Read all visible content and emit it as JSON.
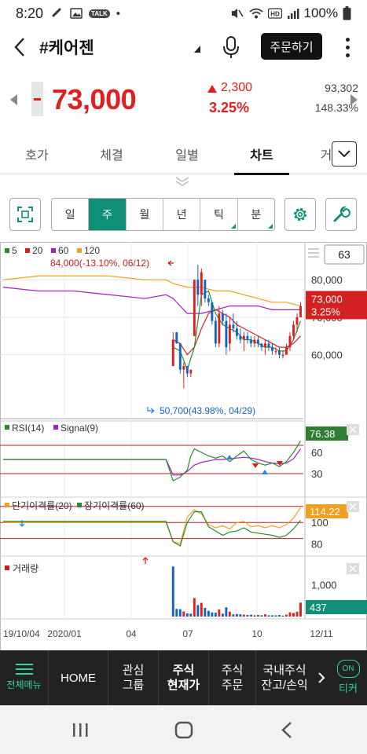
{
  "status": {
    "time": "8:20",
    "battery": "100%"
  },
  "header": {
    "stock_name": "#케어젠",
    "order_label": "주문하기"
  },
  "price": {
    "current": "73,000",
    "change": "2,300",
    "change_pct": "3.25%",
    "volume": "93,302",
    "volume_ratio": "148.33%"
  },
  "tabs": [
    "호가",
    "체결",
    "일별",
    "차트",
    "거"
  ],
  "active_tab": "차트",
  "periods": [
    "일",
    "주",
    "월",
    "년",
    "틱",
    "분"
  ],
  "active_period": "주",
  "chart_data": {
    "type": "candlestick",
    "x_tick_labels": [
      "19/10/04",
      "2020/01",
      "04",
      "07",
      "10",
      "12/11"
    ],
    "price_panel": {
      "legend": [
        {
          "name": "5",
          "color": "#2a8a2a"
        },
        {
          "name": "20",
          "color": "#d62020"
        },
        {
          "name": "60",
          "color": "#a020c0"
        },
        {
          "name": "120",
          "color": "#f0a020"
        }
      ],
      "y_ticks": [
        80000,
        70000,
        60000
      ],
      "ylim": [
        44000,
        88000
      ],
      "period_box": "63",
      "current_badge": {
        "price": "73,000",
        "pct": "3.25%"
      },
      "high_annotation": "84,000(-13.10%, 06/12)",
      "low_annotation": "50,700(43.98%, 04/29)",
      "candles": [
        [
          48,
          57,
          66,
          57,
          64
        ],
        [
          49,
          66,
          66,
          63,
          63
        ],
        [
          50,
          63,
          63,
          55,
          56
        ],
        [
          51,
          56,
          58,
          51,
          57
        ],
        [
          52,
          57,
          57,
          54,
          55
        ],
        [
          53,
          55,
          56,
          54,
          56
        ],
        [
          54,
          65,
          80,
          65,
          80
        ],
        [
          55,
          80,
          84,
          73,
          76
        ],
        [
          56,
          76,
          83,
          73,
          82
        ],
        [
          57,
          80,
          80,
          74,
          75
        ],
        [
          58,
          75,
          76,
          73,
          74
        ],
        [
          59,
          74,
          74,
          68,
          69
        ],
        [
          60,
          69,
          70,
          62,
          63
        ],
        [
          61,
          63,
          73,
          62,
          71
        ],
        [
          62,
          71,
          72,
          68,
          69
        ],
        [
          63,
          69,
          71,
          60,
          62
        ],
        [
          64,
          63,
          70,
          61,
          68
        ],
        [
          65,
          68,
          71,
          66,
          67
        ],
        [
          66,
          67,
          69,
          64,
          65
        ],
        [
          67,
          65,
          67,
          63,
          64
        ],
        [
          68,
          64,
          66,
          61,
          65
        ],
        [
          69,
          65,
          66,
          63,
          64
        ],
        [
          70,
          64,
          65,
          62,
          63
        ],
        [
          71,
          63,
          65,
          62,
          64
        ],
        [
          72,
          64,
          65,
          62,
          63
        ],
        [
          73,
          63,
          63,
          61,
          62
        ],
        [
          74,
          62,
          64,
          60,
          63
        ],
        [
          75,
          63,
          64,
          61,
          62
        ],
        [
          76,
          62,
          63,
          60,
          61
        ],
        [
          77,
          61,
          62,
          60,
          61
        ],
        [
          78,
          61,
          62,
          59,
          60
        ],
        [
          79,
          60,
          61,
          59,
          60
        ],
        [
          80,
          60,
          63,
          60,
          62
        ],
        [
          81,
          62,
          66,
          61,
          65
        ],
        [
          82,
          65,
          69,
          64,
          68
        ],
        [
          83,
          68,
          71,
          66,
          70
        ],
        [
          84,
          70,
          74,
          70,
          73
        ]
      ],
      "ma5": [
        [
          48,
          62
        ],
        [
          50,
          61
        ],
        [
          52,
          56
        ],
        [
          54,
          62
        ],
        [
          56,
          76
        ],
        [
          58,
          77
        ],
        [
          60,
          71
        ],
        [
          62,
          68
        ],
        [
          64,
          67
        ],
        [
          66,
          66
        ],
        [
          68,
          64
        ],
        [
          70,
          64
        ],
        [
          72,
          63
        ],
        [
          74,
          62
        ],
        [
          76,
          62
        ],
        [
          78,
          61
        ],
        [
          80,
          61
        ],
        [
          82,
          64
        ],
        [
          84,
          69
        ]
      ],
      "ma20": [
        [
          48,
          64
        ],
        [
          50,
          63
        ],
        [
          52,
          60
        ],
        [
          54,
          62
        ],
        [
          56,
          67
        ],
        [
          58,
          71
        ],
        [
          60,
          72
        ],
        [
          62,
          71
        ],
        [
          64,
          70
        ],
        [
          66,
          68
        ],
        [
          68,
          67
        ],
        [
          70,
          66
        ],
        [
          72,
          65
        ],
        [
          74,
          64
        ],
        [
          76,
          63
        ],
        [
          78,
          62
        ],
        [
          80,
          62
        ],
        [
          82,
          63
        ],
        [
          84,
          65
        ]
      ],
      "ma60": [
        [
          0,
          78
        ],
        [
          10,
          77
        ],
        [
          20,
          77
        ],
        [
          30,
          76
        ],
        [
          40,
          75
        ],
        [
          46,
          76
        ],
        [
          48,
          75
        ],
        [
          52,
          71
        ],
        [
          56,
          71
        ],
        [
          60,
          72
        ],
        [
          64,
          73
        ],
        [
          68,
          73
        ],
        [
          72,
          73
        ],
        [
          76,
          72
        ],
        [
          80,
          72
        ],
        [
          84,
          72
        ]
      ],
      "ma120": [
        [
          0,
          80
        ],
        [
          10,
          81
        ],
        [
          20,
          81
        ],
        [
          30,
          81
        ],
        [
          40,
          80
        ],
        [
          46,
          80
        ],
        [
          48,
          79
        ],
        [
          52,
          78
        ],
        [
          56,
          78
        ],
        [
          60,
          77
        ],
        [
          64,
          77
        ],
        [
          68,
          76
        ],
        [
          72,
          75
        ],
        [
          76,
          74
        ],
        [
          80,
          74
        ],
        [
          84,
          73
        ]
      ]
    },
    "rsi_panel": {
      "legend": [
        {
          "name": "RSI(14)",
          "color": "#2a8a2a"
        },
        {
          "name": "Signal(9)",
          "color": "#a020c0"
        }
      ],
      "y_ticks": [
        60,
        30
      ],
      "value_badge": "76.38",
      "rsi": [
        [
          0,
          50
        ],
        [
          46,
          50
        ],
        [
          48,
          20
        ],
        [
          50,
          25
        ],
        [
          52,
          35
        ],
        [
          53,
          55
        ],
        [
          54,
          65
        ],
        [
          56,
          60
        ],
        [
          58,
          55
        ],
        [
          60,
          52
        ],
        [
          62,
          55
        ],
        [
          64,
          47
        ],
        [
          66,
          55
        ],
        [
          68,
          62
        ],
        [
          70,
          50
        ],
        [
          72,
          45
        ],
        [
          74,
          42
        ],
        [
          76,
          45
        ],
        [
          78,
          40
        ],
        [
          80,
          47
        ],
        [
          82,
          60
        ],
        [
          84,
          76
        ]
      ],
      "signal": [
        [
          0,
          50
        ],
        [
          46,
          50
        ],
        [
          48,
          28
        ],
        [
          50,
          28
        ],
        [
          52,
          33
        ],
        [
          54,
          42
        ],
        [
          56,
          46
        ],
        [
          58,
          48
        ],
        [
          60,
          50
        ],
        [
          62,
          50
        ],
        [
          64,
          51
        ],
        [
          66,
          52
        ],
        [
          68,
          53
        ],
        [
          70,
          52
        ],
        [
          72,
          50
        ],
        [
          74,
          47
        ],
        [
          76,
          45
        ],
        [
          78,
          44
        ],
        [
          80,
          45
        ],
        [
          82,
          51
        ],
        [
          84,
          65
        ]
      ]
    },
    "disparity_panel": {
      "legend": [
        {
          "name": "단기이격률(20)",
          "color": "#f0a020"
        },
        {
          "name": "장기이격률(60)",
          "color": "#2a8a2a"
        }
      ],
      "y_ticks": [
        100,
        80
      ],
      "value_badge": "114.22",
      "short": [
        [
          0,
          100
        ],
        [
          46,
          100
        ],
        [
          48,
          82
        ],
        [
          50,
          80
        ],
        [
          52,
          105
        ],
        [
          54,
          112
        ],
        [
          56,
          108
        ],
        [
          58,
          98
        ],
        [
          60,
          95
        ],
        [
          62,
          97
        ],
        [
          64,
          94
        ],
        [
          66,
          100
        ],
        [
          68,
          101
        ],
        [
          70,
          96
        ],
        [
          72,
          97
        ],
        [
          74,
          95
        ],
        [
          76,
          97
        ],
        [
          78,
          95
        ],
        [
          80,
          98
        ],
        [
          82,
          104
        ],
        [
          84,
          114
        ]
      ],
      "long": [
        [
          0,
          101
        ],
        [
          46,
          101
        ],
        [
          48,
          82
        ],
        [
          50,
          78
        ],
        [
          52,
          100
        ],
        [
          54,
          110
        ],
        [
          56,
          110
        ],
        [
          58,
          96
        ],
        [
          60,
          92
        ],
        [
          62,
          88
        ],
        [
          64,
          91
        ],
        [
          66,
          92
        ],
        [
          68,
          95
        ],
        [
          70,
          91
        ],
        [
          72,
          90
        ],
        [
          74,
          89
        ],
        [
          76,
          88
        ],
        [
          78,
          86
        ],
        [
          80,
          88
        ],
        [
          82,
          94
        ],
        [
          84,
          102
        ]
      ]
    },
    "volume_panel": {
      "legend": [
        {
          "name": "거래량",
          "color": "#c02020"
        }
      ],
      "y_ticks": [
        1000
      ],
      "value_badge": "437",
      "bars": [
        [
          48,
          1570,
          "b"
        ],
        [
          49,
          240,
          "b"
        ],
        [
          50,
          230,
          "b"
        ],
        [
          51,
          160,
          "r"
        ],
        [
          52,
          100,
          "b"
        ],
        [
          53,
          90,
          "b"
        ],
        [
          54,
          580,
          "r"
        ],
        [
          55,
          360,
          "b"
        ],
        [
          56,
          430,
          "r"
        ],
        [
          57,
          270,
          "b"
        ],
        [
          58,
          180,
          "b"
        ],
        [
          59,
          130,
          "b"
        ],
        [
          60,
          120,
          "b"
        ],
        [
          61,
          220,
          "r"
        ],
        [
          62,
          90,
          "b"
        ],
        [
          63,
          290,
          "b"
        ],
        [
          64,
          150,
          "r"
        ],
        [
          65,
          70,
          "b"
        ],
        [
          66,
          80,
          "b"
        ],
        [
          67,
          70,
          "b"
        ],
        [
          68,
          60,
          "r"
        ],
        [
          69,
          50,
          "b"
        ],
        [
          70,
          60,
          "b"
        ],
        [
          71,
          40,
          "r"
        ],
        [
          72,
          50,
          "b"
        ],
        [
          73,
          40,
          "b"
        ],
        [
          74,
          70,
          "r"
        ],
        [
          75,
          40,
          "b"
        ],
        [
          76,
          40,
          "b"
        ],
        [
          77,
          40,
          "b"
        ],
        [
          78,
          50,
          "b"
        ],
        [
          79,
          30,
          "b"
        ],
        [
          80,
          60,
          "r"
        ],
        [
          81,
          130,
          "r"
        ],
        [
          82,
          110,
          "r"
        ],
        [
          83,
          150,
          "r"
        ],
        [
          84,
          437,
          "r"
        ]
      ]
    }
  },
  "bottom_nav": {
    "menu": "전체메뉴",
    "items": [
      {
        "label": "HOME",
        "bold": false
      },
      {
        "label": "관심\n그룹",
        "bold": false
      },
      {
        "label": "주식\n현재가",
        "bold": true
      },
      {
        "label": "주식\n주문",
        "bold": false
      },
      {
        "label": "국내주식\n잔고/손익",
        "bold": false
      }
    ],
    "on_label": "ON",
    "ticker": "티커"
  },
  "colors": {
    "up": "#e02020",
    "down": "#1565c0",
    "accent": "#0f8f77"
  }
}
